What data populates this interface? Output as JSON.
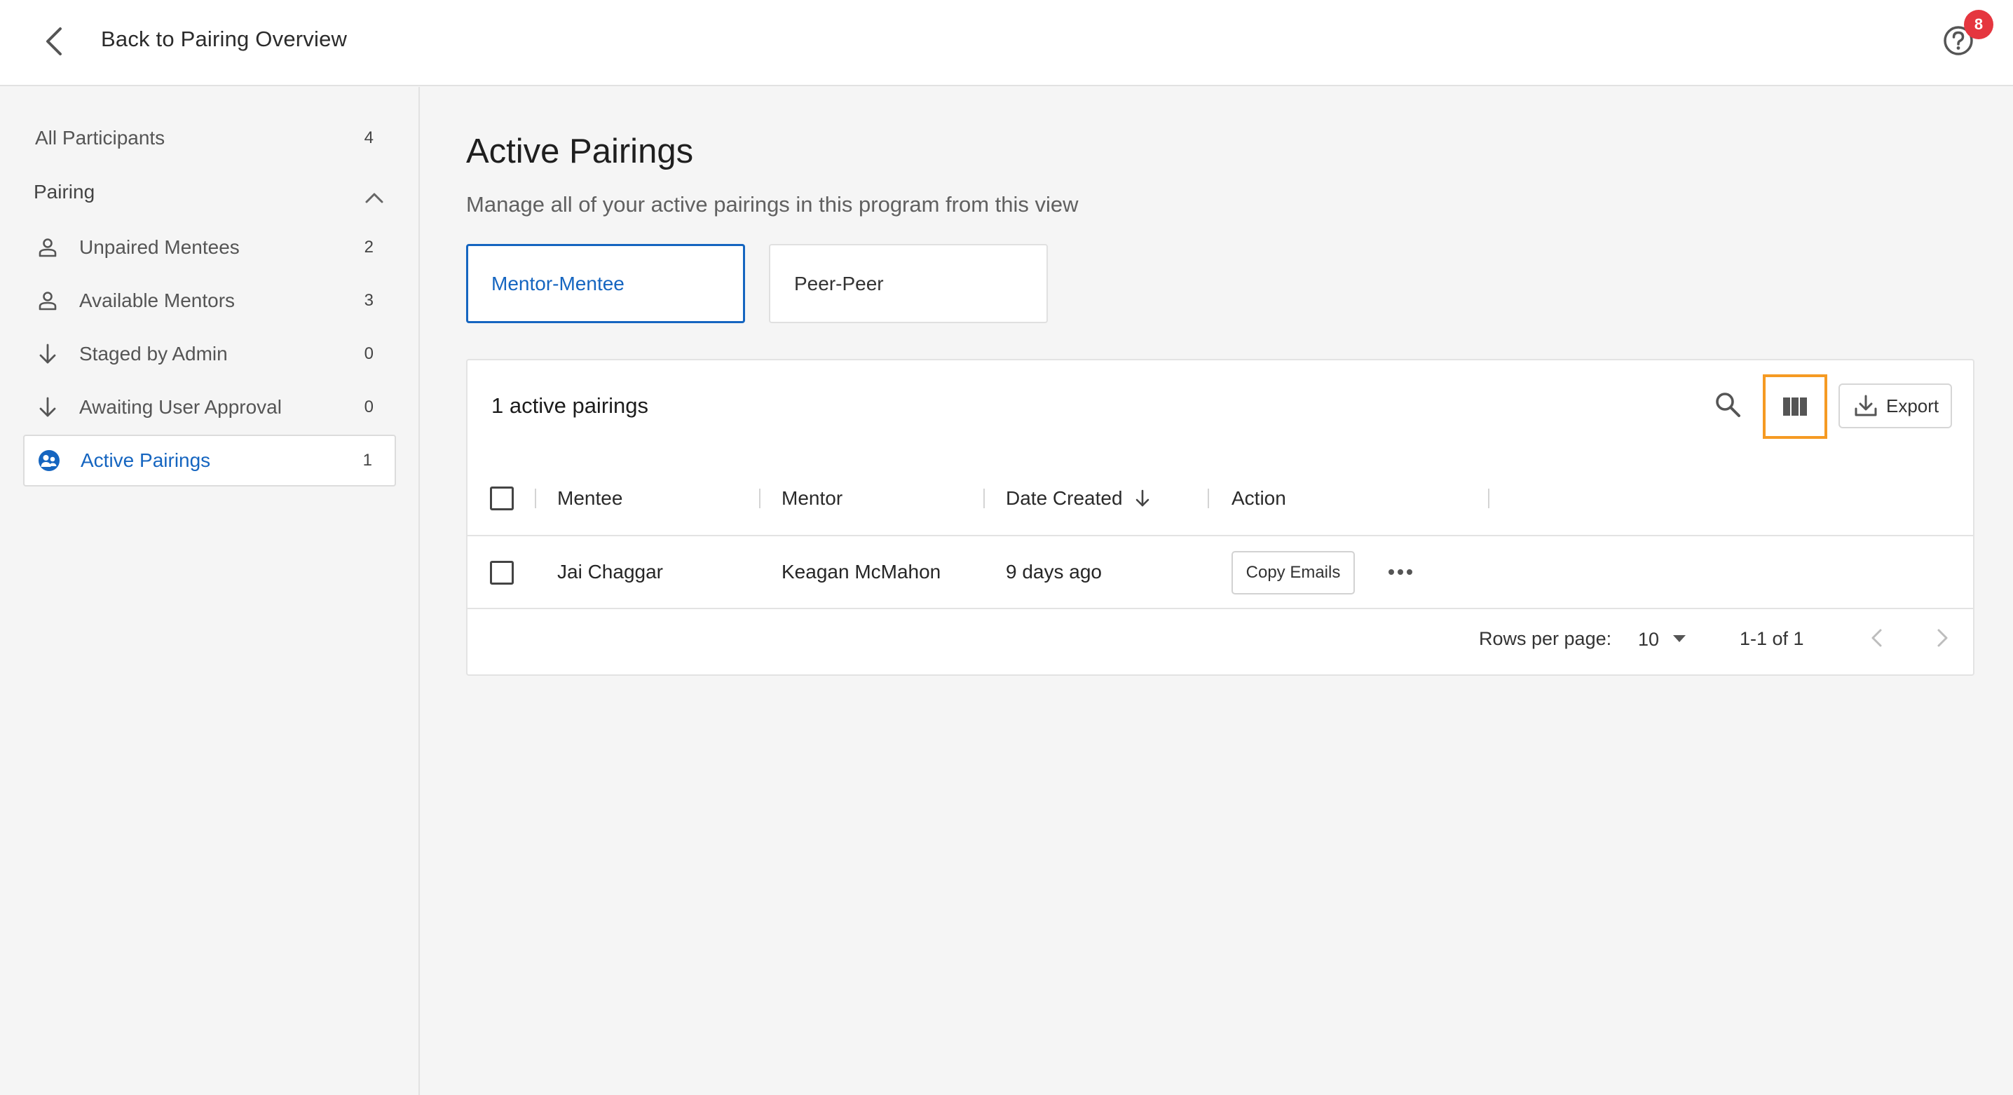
{
  "header": {
    "back_label": "Back to Pairing Overview",
    "notification_count": "8"
  },
  "sidebar": {
    "all_participants": {
      "label": "All Participants",
      "count": "4"
    },
    "section_label": "Pairing",
    "items": [
      {
        "label": "Unpaired Mentees",
        "count": "2",
        "icon": "person-icon"
      },
      {
        "label": "Available Mentors",
        "count": "3",
        "icon": "person-icon"
      },
      {
        "label": "Staged by Admin",
        "count": "0",
        "icon": "arrow-down-icon"
      },
      {
        "label": "Awaiting User Approval",
        "count": "0",
        "icon": "arrow-down-icon"
      },
      {
        "label": "Active Pairings",
        "count": "1",
        "icon": "pairing-icon",
        "active": true
      }
    ]
  },
  "main": {
    "title": "Active Pairings",
    "subtitle": "Manage all of your active pairings in this program from this view",
    "tabs": [
      {
        "label": "Mentor-Mentee",
        "selected": true
      },
      {
        "label": "Peer-Peer",
        "selected": false
      }
    ],
    "table": {
      "title": "1 active pairings",
      "export_label": "Export",
      "columns": [
        "Mentee",
        "Mentor",
        "Date Created",
        "Action"
      ],
      "rows": [
        {
          "mentee": "Jai Chaggar",
          "mentor": "Keagan McMahon",
          "date_created": "9 days ago",
          "action_label": "Copy Emails"
        }
      ],
      "pagination": {
        "rows_per_page_label": "Rows per page:",
        "rows_per_page_value": "10",
        "range": "1-1 of 1"
      }
    }
  },
  "colors": {
    "accent": "#1565c0",
    "highlight": "#f59a23",
    "badge": "#e5363f"
  }
}
